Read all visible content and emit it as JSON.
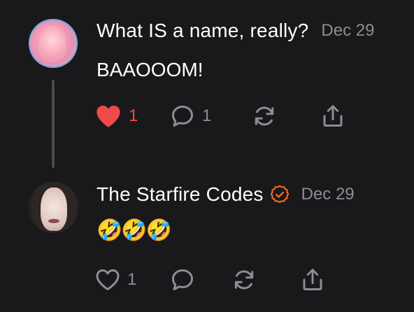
{
  "comments": [
    {
      "author": "What IS a name, really?",
      "date": "Dec 29",
      "body": "BAAOOOM!",
      "likes": "1",
      "liked": true,
      "replies": "1"
    },
    {
      "author": "The Starfire Codes",
      "date": "Dec 29",
      "body": "🤣🤣🤣",
      "verified": true,
      "likes": "1",
      "liked": false,
      "replies": ""
    }
  ],
  "colors": {
    "background": "#19191b",
    "text": "#ffffff",
    "muted": "#8d8d92",
    "like_active": "#f0494a",
    "verified_badge": "#f26c1d",
    "thread_line": "#4a4a4d"
  },
  "icons": {
    "like": "heart-icon",
    "reply": "speech-bubble-icon",
    "restack": "refresh-icon",
    "share": "share-upload-icon"
  }
}
